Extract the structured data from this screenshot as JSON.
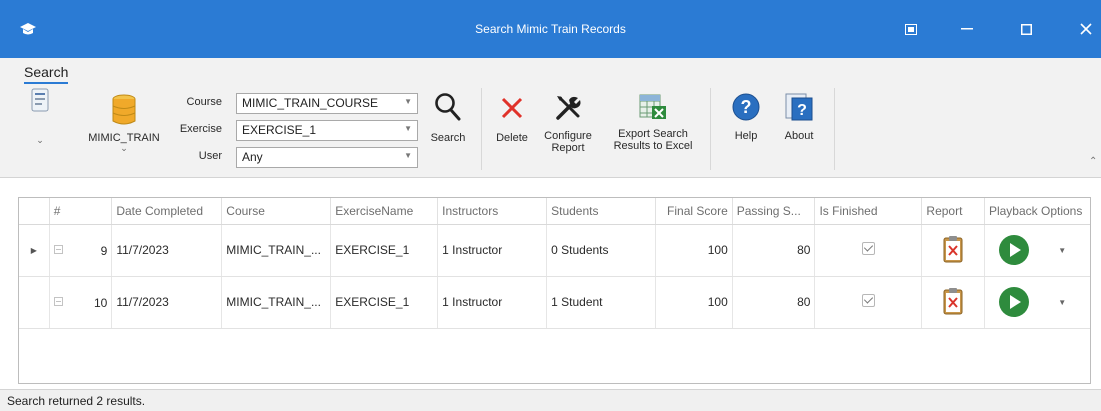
{
  "window": {
    "title": "Search Mimic Train Records",
    "title_bar_color": "#2b7bd4",
    "app_icon": "graduation-cap-icon",
    "controls": [
      "restore-down-icon",
      "minimize-icon",
      "maximize-icon",
      "close-icon"
    ]
  },
  "ribbon": {
    "tab": "Search",
    "database_label": "MIMIC_TRAIN",
    "filters": {
      "course_label": "Course",
      "course_value": "MIMIC_TRAIN_COURSE",
      "exercise_label": "Exercise",
      "exercise_value": "EXERCISE_1",
      "user_label": "User",
      "user_value": "Any"
    },
    "buttons": {
      "search": "Search",
      "delete": "Delete",
      "configure_line1": "Configure",
      "configure_line2": "Report",
      "export_line1": "Export Search",
      "export_line2": "Results to Excel",
      "help": "Help",
      "about": "About"
    }
  },
  "grid": {
    "columns": [
      "#",
      "Date Completed",
      "Course",
      "ExerciseName",
      "Instructors",
      "Students",
      "Final Score",
      "Passing S...",
      "Is Finished",
      "Report",
      "Playback Options"
    ],
    "rows": [
      {
        "num": "9",
        "date": "11/7/2023",
        "course": "MIMIC_TRAIN_...",
        "exercise": "EXERCISE_1",
        "instructors": "1 Instructor",
        "students": "0 Students",
        "final_score": "100",
        "passing_score": "80",
        "is_finished": true
      },
      {
        "num": "10",
        "date": "11/7/2023",
        "course": "MIMIC_TRAIN_...",
        "exercise": "EXERCISE_1",
        "instructors": "1 Instructor",
        "students": "1 Student",
        "final_score": "100",
        "passing_score": "80",
        "is_finished": true
      }
    ]
  },
  "status": {
    "text": "Search returned 2 results."
  },
  "colors": {
    "accent": "#2b7bd4",
    "delete_red": "#e0322a",
    "play_green": "#2e8b3d",
    "help_blue": "#2a6fc0"
  }
}
